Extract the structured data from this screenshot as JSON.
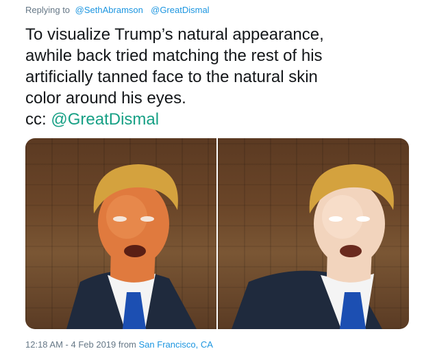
{
  "reply": {
    "prefix": "Replying to",
    "mentions": [
      "@SethAbramson",
      "@GreatDismal"
    ]
  },
  "tweet": {
    "lines": [
      "To visualize Trump’s natural appearance,",
      "awhile back tried matching the rest of his",
      "artificially tanned face to the natural skin",
      "color around his eyes."
    ],
    "cc_prefix": "cc:",
    "cc_mention": "@GreatDismal"
  },
  "media": {
    "photos": [
      {
        "skin": "#e07a3e",
        "highlight": "#f09a5a"
      },
      {
        "skin": "#f2d4bd",
        "highlight": "#fbe6d6"
      }
    ],
    "colors": {
      "hair": "#d4a23e",
      "suit": "#1f2a3d",
      "shirt": "#f4f4f4",
      "tie": "#1c4fb2"
    }
  },
  "meta": {
    "timestamp": "12:18 AM - 4 Feb 2019",
    "from_label": "from",
    "location": "San Francisco, CA"
  },
  "colors": {
    "link": "#1b95e0",
    "cc_link": "#17a085",
    "muted": "#657786",
    "text": "#14171a"
  }
}
